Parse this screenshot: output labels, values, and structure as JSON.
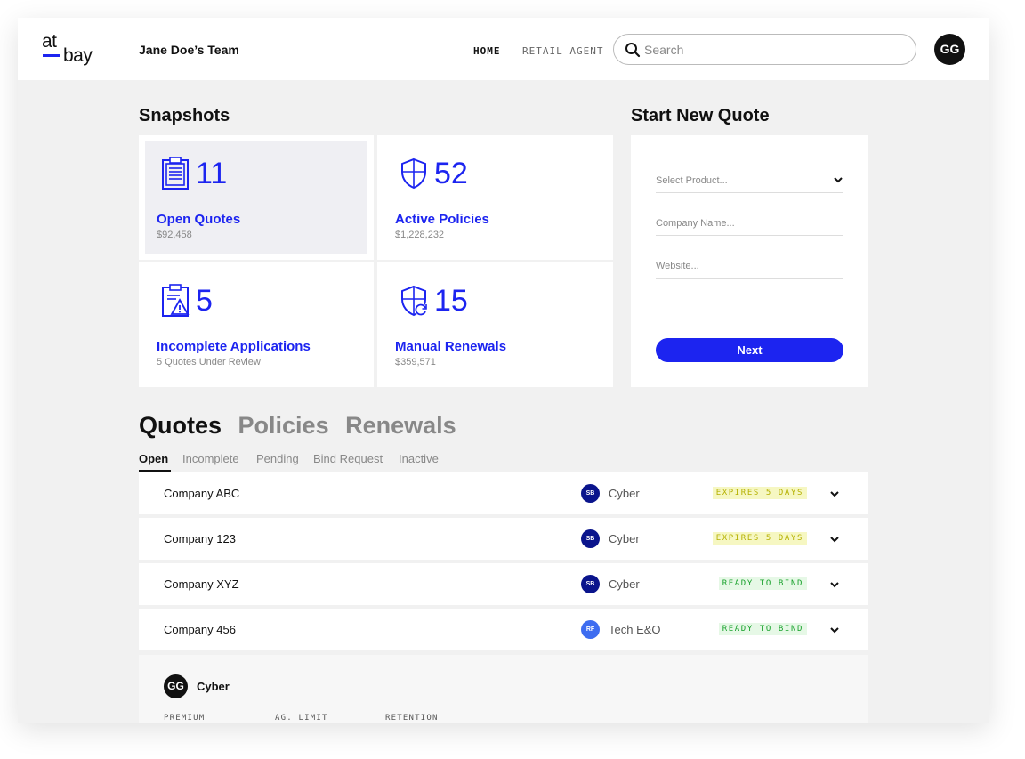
{
  "header": {
    "logo_top": "at",
    "logo_bottom": "bay",
    "team_name": "Jane Doe’s Team",
    "nav": {
      "home": "HOME",
      "retail_agent": "RETAIL AGENT"
    },
    "search_placeholder": "Search",
    "user_initials": "GG"
  },
  "snapshots": {
    "title": "Snapshots",
    "cards": [
      {
        "icon": "clipboard-list-icon",
        "count": "11",
        "label": "Open Quotes",
        "sub": "$92,458"
      },
      {
        "icon": "shield-icon",
        "count": "52",
        "label": "Active Policies",
        "sub": "$1,228,232"
      },
      {
        "icon": "clipboard-warning-icon",
        "count": "5",
        "label": "Incomplete Applications",
        "sub": "5 Quotes Under Review"
      },
      {
        "icon": "shield-refresh-icon",
        "count": "15",
        "label": "Manual Renewals",
        "sub": "$359,571"
      }
    ]
  },
  "new_quote": {
    "title": "Start New Quote",
    "product_placeholder": "Select Product...",
    "company_placeholder": "Company Name...",
    "website_placeholder": "Website...",
    "next_label": "Next"
  },
  "list": {
    "tabs": [
      "Quotes",
      "Policies",
      "Renewals"
    ],
    "subtabs": [
      "Open",
      "Incomplete",
      "Pending",
      "Bind Request",
      "Inactive"
    ],
    "rows": [
      {
        "company": "Company ABC",
        "badge": "SB",
        "badge_color": "#0a148c",
        "product": "Cyber",
        "status": "EXPIRES 5 DAYS",
        "status_fg": "#b5b000",
        "status_bg": "#f6f7c2"
      },
      {
        "company": "Company 123",
        "badge": "SB",
        "badge_color": "#0a148c",
        "product": "Cyber",
        "status": "EXPIRES 5 DAYS",
        "status_fg": "#b5b000",
        "status_bg": "#f6f7c2"
      },
      {
        "company": "Company XYZ",
        "badge": "SB",
        "badge_color": "#0a148c",
        "product": "Cyber",
        "status": "READY TO BIND",
        "status_fg": "#17a12b",
        "status_bg": "#e6f8e6"
      },
      {
        "company": "Company 456",
        "badge": "RF",
        "badge_color": "#3d6cf0",
        "product": "Tech E&O",
        "status": "READY TO BIND",
        "status_fg": "#17a12b",
        "status_bg": "#e6f8e6"
      }
    ],
    "detail": {
      "initials": "GG",
      "product": "Cyber",
      "columns": [
        "PREMIUM",
        "AG. LIMIT",
        "RETENTION"
      ]
    }
  },
  "colors": {
    "accent": "#1c24f0",
    "background": "#f1f1f1"
  }
}
